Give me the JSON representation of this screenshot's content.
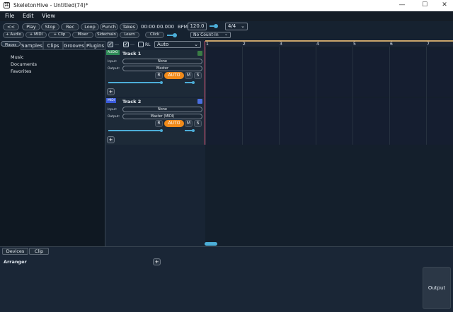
{
  "window": {
    "title": "SkeletonHive - Untitled(74)*",
    "logo_icon": "skeleton-hive-logo",
    "controls": [
      "—",
      "☐",
      "✕"
    ]
  },
  "menu": [
    "File",
    "Edit",
    "View"
  ],
  "transport": {
    "rewind": "<<",
    "play": "Play",
    "stop": "Stop",
    "rec": "Rec",
    "loop": "Loop",
    "punch": "Punch",
    "takes": "Takes",
    "time": "00:00:00.000",
    "bpm_label": "BPM",
    "bpm": "120.0",
    "time_sig": "4/4"
  },
  "toolbar2": {
    "add_audio": "+ Audio",
    "add_midi": "+ MIDI",
    "add_clip": "+ Clip",
    "mixer": "Mixer",
    "sidechain": "Sidechain",
    "learn": "Learn",
    "click": "Click",
    "count_in": "No Count-In"
  },
  "browser": {
    "tabs": [
      "Places",
      "Samples",
      "Clips",
      "Grooves",
      "Plugins"
    ],
    "places": [
      "Music",
      "Documents",
      "Favorites"
    ]
  },
  "track_toolbar": {
    "rl_label": "RL",
    "mode": "Auto"
  },
  "tracks": [
    {
      "tag": "AUDIO",
      "tag_color": "#2e8b57",
      "name": "Track 1",
      "input_label": "Input:",
      "input": "None",
      "output_label": "Output:",
      "output": "Master",
      "r": "R",
      "auto": "AUTO",
      "m": "M",
      "s": "S",
      "color": "#3a7d45",
      "volume": 0.72,
      "pan": 0.5
    },
    {
      "tag": "MIDI",
      "tag_color": "#3b5bdb",
      "name": "Track 2",
      "input_label": "Input:",
      "input": "None",
      "output_label": "Output:",
      "output": "Master (MIDI)",
      "r": "R",
      "auto": "AUTO",
      "m": "M",
      "s": "S",
      "color": "#4a6ee0",
      "volume": 0.72,
      "pan": 0.5
    }
  ],
  "ruler": [
    "1",
    "2",
    "3",
    "4",
    "5",
    "6",
    "7"
  ],
  "bottom": {
    "tabs": [
      "Devices",
      "Clip"
    ],
    "arranger_label": "Arranger",
    "add": "+",
    "output": "Output"
  },
  "colors": {
    "accent": "#4caed8",
    "auto": "#f08a1a",
    "playhead": "#e05a7a"
  }
}
